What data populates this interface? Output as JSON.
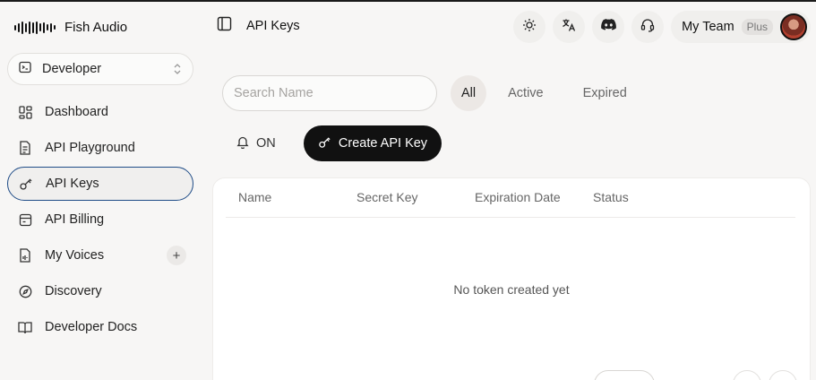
{
  "app": {
    "name": "Fish Audio"
  },
  "workspace": {
    "label": "Developer"
  },
  "sidebar": {
    "items": [
      {
        "label": "Dashboard",
        "icon": "dashboard-icon"
      },
      {
        "label": "API Playground",
        "icon": "document-icon"
      },
      {
        "label": "API Keys",
        "icon": "key-icon",
        "active": true
      },
      {
        "label": "API Billing",
        "icon": "billing-icon"
      },
      {
        "label": "My Voices",
        "icon": "voice-file-icon",
        "action": "+"
      },
      {
        "label": "Discovery",
        "icon": "compass-icon"
      },
      {
        "label": "Developer Docs",
        "icon": "book-icon"
      }
    ]
  },
  "header": {
    "title": "API Keys",
    "icons": [
      "sun-icon",
      "translate-icon",
      "discord-icon",
      "headset-icon"
    ],
    "team": {
      "name": "My Team",
      "plan": "Plus"
    }
  },
  "filters": {
    "search_placeholder": "Search Name",
    "search_value": "",
    "tabs": [
      {
        "label": "All",
        "active": true
      },
      {
        "label": "Active"
      },
      {
        "label": "Expired"
      }
    ]
  },
  "actions": {
    "notify_label": "ON",
    "create_label": "Create API Key"
  },
  "table": {
    "columns": [
      "Name",
      "Secret Key",
      "Expiration Date",
      "Status"
    ],
    "empty_text": "No token created yet"
  },
  "colors": {
    "accent_border": "#1f4c87",
    "primary_button": "#111111",
    "page_background": "#f7f6f5"
  }
}
